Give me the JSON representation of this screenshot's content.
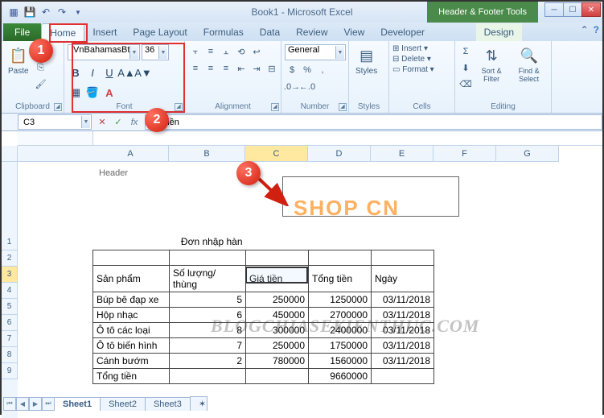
{
  "title": "Book1 - Microsoft Excel",
  "context_tool": "Header & Footer Tools",
  "ribbon": {
    "file": "File",
    "tabs": [
      "Home",
      "Insert",
      "Page Layout",
      "Formulas",
      "Data",
      "Review",
      "View",
      "Developer"
    ],
    "design": "Design",
    "groups": {
      "clipboard": {
        "label": "Clipboard",
        "paste": "Paste"
      },
      "font": {
        "label": "Font",
        "name": ".VnBahamasBt",
        "size": "36"
      },
      "alignment": {
        "label": "Alignment"
      },
      "number": {
        "label": "Number",
        "format": "General"
      },
      "styles": {
        "label": "Styles",
        "btn": "Styles"
      },
      "cells": {
        "label": "Cells",
        "insert": "Insert",
        "delete": "Delete",
        "format": "Format"
      },
      "editing": {
        "label": "Editing",
        "sort": "Sort & Filter",
        "find": "Find & Select"
      }
    }
  },
  "namebox": "C3",
  "fx": "fx",
  "formula": "Giá tiền",
  "columns": [
    "A",
    "B",
    "C",
    "D",
    "E",
    "F",
    "G"
  ],
  "rows": [
    "1",
    "2",
    "3",
    "4",
    "5",
    "6",
    "7",
    "8",
    "9"
  ],
  "header_label": "Header",
  "shop_text": "SHOP CN",
  "table": {
    "title": "Đơn nhập hàn",
    "headers": [
      "Sản phẩm",
      "Số lượng/ thùng",
      "Giá tiền",
      "Tổng tiền",
      "Ngày"
    ],
    "rows": [
      {
        "p": "Búp bê đạp xe",
        "q": "5",
        "price": "250000",
        "total": "1250000",
        "date": "03/11/2018"
      },
      {
        "p": "Hộp nhạc",
        "q": "6",
        "price": "450000",
        "total": "2700000",
        "date": "03/11/2018"
      },
      {
        "p": "Ô tô các loại",
        "q": "8",
        "price": "300000",
        "total": "2400000",
        "date": "03/11/2018"
      },
      {
        "p": "Ô tô biến hình",
        "q": "7",
        "price": "250000",
        "total": "1750000",
        "date": "03/11/2018"
      },
      {
        "p": "Cánh bướm",
        "q": "2",
        "price": "780000",
        "total": "1560000",
        "date": "03/11/2018"
      }
    ],
    "footer_label": "Tổng tiền",
    "footer_total": "9660000"
  },
  "sheets": [
    "Sheet1",
    "Sheet2",
    "Sheet3"
  ],
  "watermark": "BLOGCHIASEKIENTHUC.COM",
  "callouts": {
    "1": "1",
    "2": "2",
    "3": "3"
  }
}
